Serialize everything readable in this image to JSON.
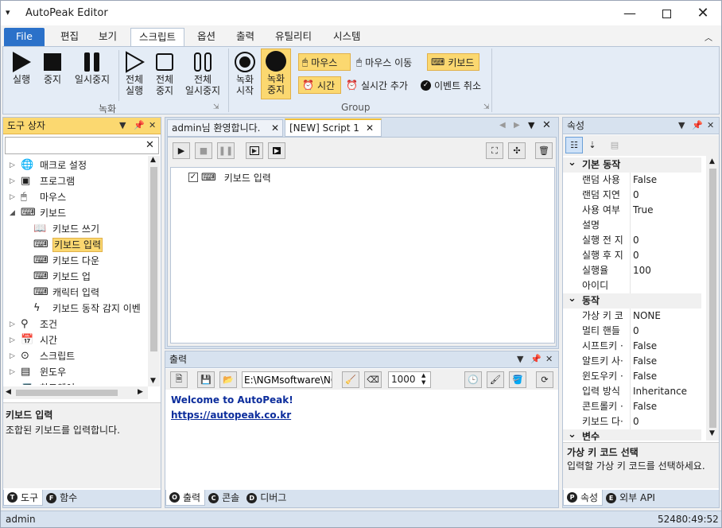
{
  "app": {
    "title": "AutoPeak Editor"
  },
  "menu_tabs": [
    "File",
    "편집",
    "보기",
    "스크립트",
    "옵션",
    "출력",
    "유틸리티",
    "시스템"
  ],
  "ribbon": {
    "record_group_label": "녹화",
    "group_label": "Group",
    "buttons": {
      "run": [
        "실행"
      ],
      "stop": [
        "중지"
      ],
      "pause": [
        "일시중지"
      ],
      "run_all": [
        "전체",
        "실행"
      ],
      "stop_all": [
        "전체",
        "중지"
      ],
      "pause_all": [
        "전체",
        "일시중지"
      ],
      "rec_start": [
        "녹화",
        "시작"
      ],
      "rec_stop": [
        "녹화",
        "중지"
      ]
    },
    "record_options": {
      "mouse": "마우스",
      "mouse_move": "마우스 이동",
      "keyboard": "키보드",
      "time": "시간",
      "add_realtime": "실시간 추가",
      "cancel_event": "이벤트 취소"
    }
  },
  "toolbox": {
    "title": "도구 상자",
    "search_value": "",
    "tree": [
      {
        "label": "매크로 설정",
        "level": 0,
        "icon": "globe-icon",
        "exp": "right"
      },
      {
        "label": "프로그램",
        "level": 0,
        "icon": "program-icon",
        "exp": "right"
      },
      {
        "label": "마우스",
        "level": 0,
        "icon": "mouse-icon",
        "exp": "right"
      },
      {
        "label": "키보드",
        "level": 0,
        "icon": "keyboard-icon",
        "exp": "down"
      },
      {
        "label": "키보드 쓰기",
        "level": 1,
        "icon": "book-icon",
        "exp": ""
      },
      {
        "label": "키보드 입력",
        "level": 1,
        "icon": "keyboard-icon",
        "exp": "",
        "selected": true
      },
      {
        "label": "키보드 다운",
        "level": 1,
        "icon": "keyboard-down-icon",
        "exp": ""
      },
      {
        "label": "키보드 업",
        "level": 1,
        "icon": "keyboard-up-icon",
        "exp": ""
      },
      {
        "label": "캐릭터 입력",
        "level": 1,
        "icon": "character-icon",
        "exp": ""
      },
      {
        "label": "키보드 동작 감지 이벤",
        "level": 1,
        "icon": "lightning-icon",
        "exp": ""
      },
      {
        "label": "조건",
        "level": 0,
        "icon": "condition-icon",
        "exp": "right"
      },
      {
        "label": "시간",
        "level": 0,
        "icon": "calendar-icon",
        "exp": "right"
      },
      {
        "label": "스크립트",
        "level": 0,
        "icon": "script-icon",
        "exp": "right"
      },
      {
        "label": "윈도우",
        "level": 0,
        "icon": "window-icon",
        "exp": "right"
      },
      {
        "label": "하드웨어",
        "level": 0,
        "icon": "laptop-icon",
        "exp": "right"
      }
    ],
    "desc_title": "키보드 입력",
    "desc_text": "조합된 키보드를 입력합니다.",
    "bottom_tabs": [
      {
        "label": "도구",
        "letter": "T"
      },
      {
        "label": "함수",
        "letter": "F"
      }
    ]
  },
  "documents": {
    "tabs": [
      {
        "label": "admin님 환영합니다."
      },
      {
        "label": "[NEW] Script 1",
        "active": true
      }
    ],
    "script_item": "키보드 입력"
  },
  "output": {
    "title": "출력",
    "path": "E:\\NGMsoftware\\NG",
    "delay": "1000",
    "lines": [
      "Welcome to AutoPeak!",
      "https://autopeak.co.kr"
    ],
    "bottom_tabs": [
      {
        "label": "출력",
        "letter": "O"
      },
      {
        "label": "콘솔",
        "letter": "C"
      },
      {
        "label": "디버그",
        "letter": "D"
      }
    ]
  },
  "properties": {
    "title": "속성",
    "categories": [
      {
        "name": "기본 동작",
        "rows": [
          [
            "랜덤 사용",
            "False"
          ],
          [
            "랜덤 지연",
            "0"
          ],
          [
            "사용 여부",
            "True"
          ],
          [
            "설명",
            ""
          ],
          [
            "실행 전 지",
            "0"
          ],
          [
            "실행 후 지",
            "0"
          ],
          [
            "실행율",
            "100"
          ],
          [
            "아이디",
            ""
          ]
        ]
      },
      {
        "name": "동작",
        "rows": [
          [
            "가상 키 코",
            "NONE"
          ],
          [
            "멀티 핸들",
            "0"
          ],
          [
            "시프트키 ·",
            "False"
          ],
          [
            "알트키 사·",
            "False"
          ],
          [
            "윈도우키 ·",
            "False"
          ],
          [
            "입력 방식",
            "Inheritance"
          ],
          [
            "콘트롤키 ·",
            "False"
          ],
          [
            "키보드 다·",
            "0"
          ]
        ]
      },
      {
        "name": "변수",
        "rows": []
      }
    ],
    "desc_title": "가상 키 코드 선택",
    "desc_text": "입력할 가상 키 코드를 선택하세요.",
    "bottom_tabs": [
      {
        "label": "속성",
        "letter": "P"
      },
      {
        "label": "외부 API",
        "letter": "E"
      }
    ]
  },
  "status": {
    "left": "admin",
    "right": "52480:49:52"
  },
  "colors": {
    "accent": "#2b71c9",
    "highlight": "#fbd870",
    "panel": "#d7e2ef",
    "link": "#0c2d9c"
  }
}
